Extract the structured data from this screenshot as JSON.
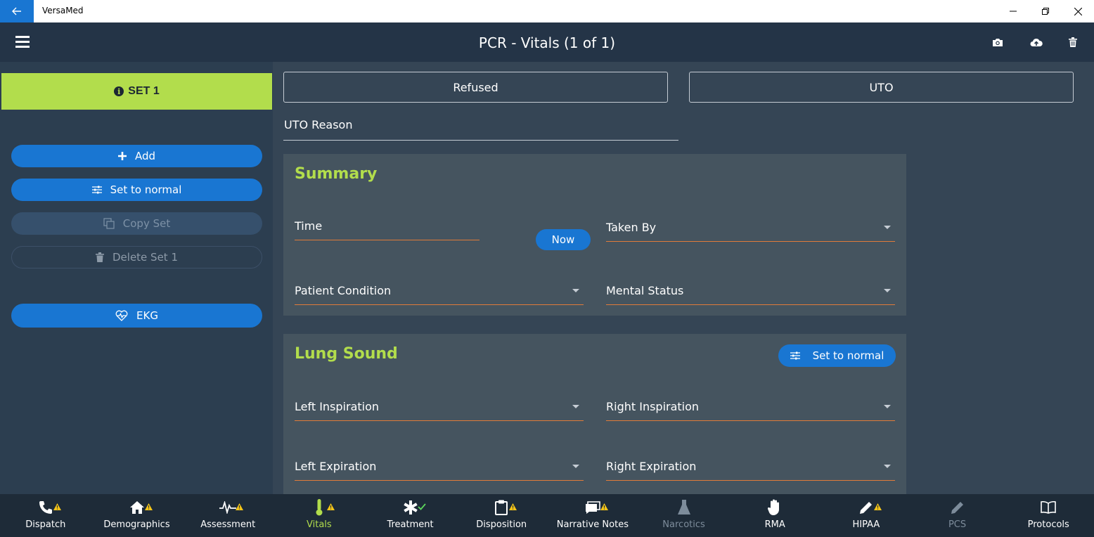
{
  "window": {
    "app_title": "VersaMed"
  },
  "header": {
    "title": "PCR - Vitals (1 of 1)"
  },
  "sidebar": {
    "set_label": "SET 1",
    "add_label": "Add",
    "set_to_normal_label": "Set to normal",
    "copy_set_label": "Copy Set",
    "delete_set_label": "Delete Set 1",
    "ekg_label": "EKG"
  },
  "main": {
    "refused_label": "Refused",
    "uto_label": "UTO",
    "uto_reason_label": "UTO Reason",
    "summary": {
      "title": "Summary",
      "time_label": "Time",
      "now_label": "Now",
      "taken_by_label": "Taken By",
      "patient_condition_label": "Patient Condition",
      "mental_status_label": "Mental Status"
    },
    "lung_sound": {
      "title": "Lung Sound",
      "set_to_normal_label": "Set to normal",
      "left_inspiration_label": "Left Inspiration",
      "right_inspiration_label": "Right Inspiration",
      "left_expiration_label": "Left Expiration",
      "right_expiration_label": "Right Expiration"
    }
  },
  "nav": {
    "items": [
      {
        "label": "Dispatch",
        "icon": "phone-icon",
        "status": "warning"
      },
      {
        "label": "Demographics",
        "icon": "home-icon",
        "status": "warning"
      },
      {
        "label": "Assessment",
        "icon": "heartbeat-icon",
        "status": "warning"
      },
      {
        "label": "Vitals",
        "icon": "thermometer-icon",
        "status": "warning",
        "active": true
      },
      {
        "label": "Treatment",
        "icon": "medical-star-icon",
        "status": "complete"
      },
      {
        "label": "Disposition",
        "icon": "clipboard-icon",
        "status": "warning"
      },
      {
        "label": "Narrative Notes",
        "icon": "notes-icon",
        "status": "warning"
      },
      {
        "label": "Narcotics",
        "icon": "flask-icon",
        "status": "disabled"
      },
      {
        "label": "RMA",
        "icon": "hand-icon",
        "status": "none"
      },
      {
        "label": "HIPAA",
        "icon": "pen-icon",
        "status": "warning"
      },
      {
        "label": "PCS",
        "icon": "pencil-icon",
        "status": "disabled"
      },
      {
        "label": "Protocols",
        "icon": "book-icon",
        "status": "none"
      }
    ]
  },
  "colors": {
    "accent_green": "#b2dd4c",
    "primary_blue": "#1976d2",
    "underline_orange": "#e07b39",
    "warning_yellow": "#f5c518",
    "complete_green": "#5cd65c"
  }
}
